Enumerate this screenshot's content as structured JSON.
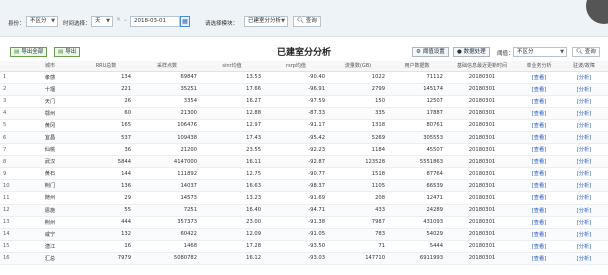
{
  "filter": {
    "area_label": "县份：",
    "area_value": "不区分",
    "time_label": "时间选择：",
    "time_unit": "天",
    "date_value": "2018-03-01",
    "module_label": "请选择模块：",
    "module_value": "已建室分分析",
    "query_label": "查询"
  },
  "toolbar": {
    "export_all": "导出全部",
    "export": "导出",
    "title": "已建室分分析",
    "threshold_setting": "阈值设置",
    "data_process": "数据处理",
    "filter_label": "阈值：",
    "filter_value": "不区分",
    "query_label": "查询"
  },
  "table": {
    "headers": [
      "",
      "城市",
      "RRU总数",
      "采样点数",
      "sinr均值",
      "rsrp均值",
      "流量数(GB)",
      "用户数据数",
      "基础信息最近更新时间",
      "单业务分析",
      "驻波/故障"
    ],
    "rows": [
      [
        "1",
        "孝感",
        "134",
        "69847",
        "13.53",
        "-90.40",
        "1022",
        "71112",
        "20180301",
        "[查看]",
        "[分析]"
      ],
      [
        "2",
        "十堰",
        "221",
        "35251",
        "17.66",
        "-96.91",
        "2799",
        "145174",
        "20180301",
        "[查看]",
        "[分析]"
      ],
      [
        "3",
        "天门",
        "26",
        "3354",
        "16.27",
        "-97.59",
        "150",
        "12507",
        "20180301",
        "[查看]",
        "[分析]"
      ],
      [
        "4",
        "鄂州",
        "60",
        "21300",
        "12.88",
        "-87.33",
        "335",
        "17887",
        "20180301",
        "[查看]",
        "[分析]"
      ],
      [
        "5",
        "黄冈",
        "165",
        "106476",
        "12.97",
        "-91.17",
        "1318",
        "80761",
        "20180301",
        "[查看]",
        "[分析]"
      ],
      [
        "6",
        "宜昌",
        "537",
        "109438",
        "17.43",
        "-95.42",
        "5269",
        "305553",
        "20180301",
        "[查看]",
        "[分析]"
      ],
      [
        "7",
        "仙桃",
        "36",
        "21200",
        "23.55",
        "-92.23",
        "1184",
        "45507",
        "20180301",
        "[查看]",
        "[分析]"
      ],
      [
        "8",
        "武汉",
        "5844",
        "4147000",
        "16.11",
        "-92.87",
        "123528",
        "5551863",
        "20180301",
        "[查看]",
        "[分析]"
      ],
      [
        "9",
        "黄石",
        "144",
        "111892",
        "12.75",
        "-90.77",
        "1518",
        "87764",
        "20180301",
        "[查看]",
        "[分析]"
      ],
      [
        "10",
        "荆门",
        "136",
        "14037",
        "16.63",
        "-98.37",
        "1105",
        "66539",
        "20180301",
        "[查看]",
        "[分析]"
      ],
      [
        "11",
        "随州",
        "29",
        "14573",
        "13.23",
        "-91.69",
        "208",
        "12471",
        "20180301",
        "[查看]",
        "[分析]"
      ],
      [
        "12",
        "恩施",
        "55",
        "7251",
        "16.40",
        "-94.71",
        "433",
        "24289",
        "20180301",
        "[查看]",
        "[分析]"
      ],
      [
        "13",
        "荆州",
        "444",
        "357373",
        "23.00",
        "-91.38",
        "7987",
        "431093",
        "20180301",
        "[查看]",
        "[分析]"
      ],
      [
        "14",
        "咸宁",
        "132",
        "60422",
        "12.09",
        "-91.05",
        "783",
        "54029",
        "20180301",
        "[查看]",
        "[分析]"
      ],
      [
        "15",
        "潜江",
        "16",
        "1468",
        "17.28",
        "-93.50",
        "71",
        "5444",
        "20180301",
        "[查看]",
        "[分析]"
      ],
      [
        "16",
        "汇总",
        "7979",
        "5080782",
        "16.12",
        "-93.03",
        "147710",
        "6911993",
        "20180301",
        "[查看]",
        "[分析]"
      ]
    ]
  }
}
